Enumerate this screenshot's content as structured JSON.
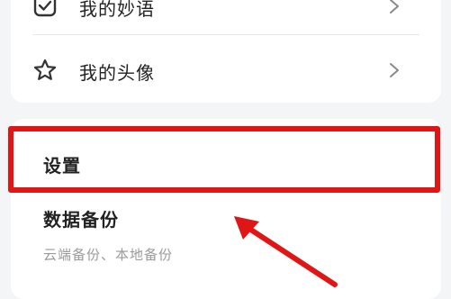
{
  "menu": {
    "items": [
      {
        "label": "我的妙语",
        "icon": "check-box-icon"
      },
      {
        "label": "我的头像",
        "icon": "star-icon"
      }
    ]
  },
  "settings": {
    "title": "设置",
    "backup": {
      "title": "数据备份",
      "subtitle": "云端备份、本地备份"
    }
  },
  "annotation": {
    "highlight_color": "#e01515"
  }
}
